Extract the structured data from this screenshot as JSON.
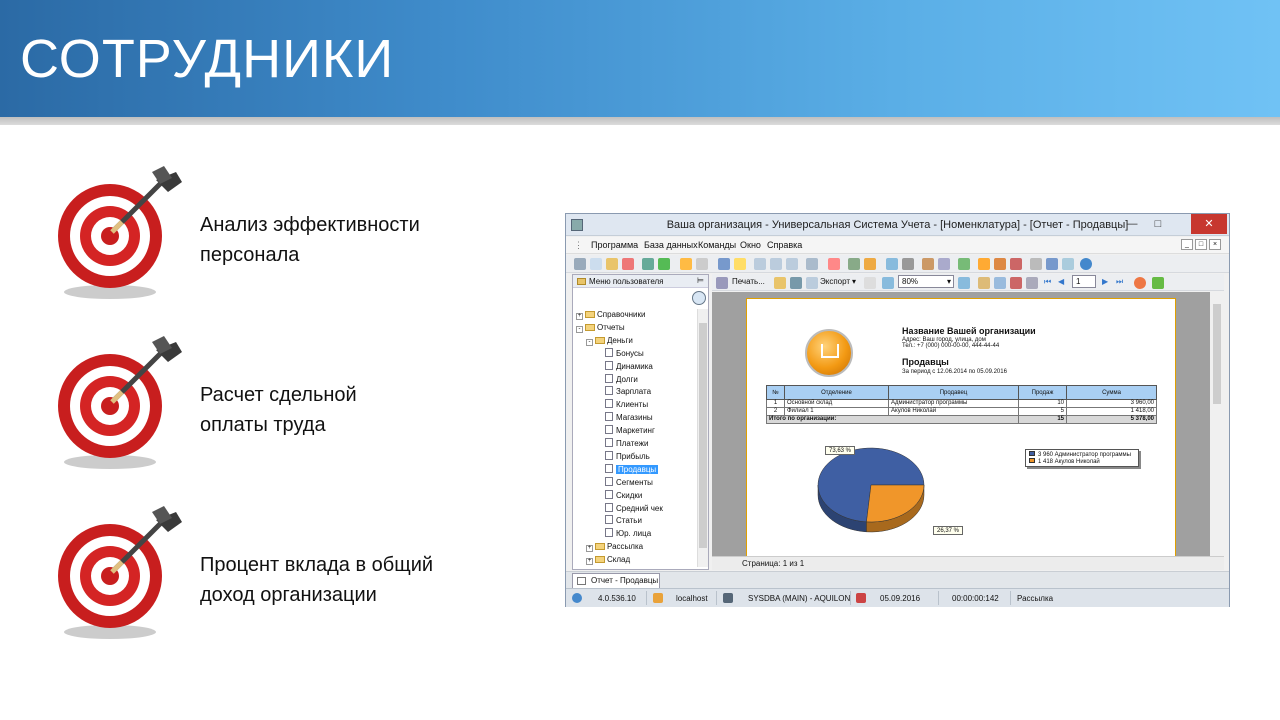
{
  "slide": {
    "title": "СОТРУДНИКИ",
    "bullets": [
      {
        "line1": "Анализ эффективности",
        "line2": "персонала"
      },
      {
        "line1": "Расчет сдельной",
        "line2": "оплаты труда"
      },
      {
        "line1": "Процент вклада в общий",
        "line2": "доход организации"
      }
    ]
  },
  "window": {
    "title": "Ваша организация - Универсальная Система Учета - [Номенклатура] - [Отчет - Продавцы]",
    "menu": [
      "Программа",
      "База данных",
      "Команды",
      "Окно",
      "Справка"
    ],
    "left_panel": {
      "title": "Меню пользователя",
      "tree": [
        {
          "label": "Справочники",
          "level": 0,
          "kind": "folder",
          "pm": "+"
        },
        {
          "label": "Отчеты",
          "level": 0,
          "kind": "folder",
          "pm": "-"
        },
        {
          "label": "Деньги",
          "level": 1,
          "kind": "folder",
          "pm": "-"
        },
        {
          "label": "Бонусы",
          "level": 2,
          "kind": "doc"
        },
        {
          "label": "Динамика",
          "level": 2,
          "kind": "doc"
        },
        {
          "label": "Долги",
          "level": 2,
          "kind": "doc"
        },
        {
          "label": "Зарплата",
          "level": 2,
          "kind": "doc"
        },
        {
          "label": "Клиенты",
          "level": 2,
          "kind": "doc"
        },
        {
          "label": "Магазины",
          "level": 2,
          "kind": "doc"
        },
        {
          "label": "Маркетинг",
          "level": 2,
          "kind": "doc"
        },
        {
          "label": "Платежи",
          "level": 2,
          "kind": "doc"
        },
        {
          "label": "Прибыль",
          "level": 2,
          "kind": "doc"
        },
        {
          "label": "Продавцы",
          "level": 2,
          "kind": "doc",
          "selected": true
        },
        {
          "label": "Сегменты",
          "level": 2,
          "kind": "doc"
        },
        {
          "label": "Скидки",
          "level": 2,
          "kind": "doc"
        },
        {
          "label": "Средний чек",
          "level": 2,
          "kind": "doc"
        },
        {
          "label": "Статьи",
          "level": 2,
          "kind": "doc"
        },
        {
          "label": "Юр. лица",
          "level": 2,
          "kind": "doc"
        },
        {
          "label": "Рассылка",
          "level": 1,
          "kind": "folder",
          "pm": "+"
        },
        {
          "label": "Склад",
          "level": 1,
          "kind": "folder",
          "pm": "+"
        }
      ]
    },
    "report_toolbar": {
      "print": "Печать...",
      "export": "Экспорт",
      "zoom": "80%",
      "page": "1"
    },
    "report": {
      "org_name": "Название Вашей организации",
      "address": "Адрес: Ваш город, улица, дом",
      "phone": "Тел.: +7 (000) 000-00-00, 444-44-44",
      "title": "Продавцы",
      "period": "За период с 12.06.2014 по 05.09.2016",
      "columns": [
        "№",
        "Отделение",
        "Продавец",
        "Продаж",
        "Сумма"
      ],
      "rows": [
        {
          "n": "1",
          "dept": "Основной склад",
          "seller": "Администратор программы",
          "sales": "10",
          "sum": "3 960,00"
        },
        {
          "n": "2",
          "dept": "Филиал 1",
          "seller": "Акулов Николай",
          "sales": "5",
          "sum": "1 418,00"
        }
      ],
      "total": {
        "label": "Итого по организации:",
        "sales": "15",
        "sum": "5 378,00"
      },
      "legend": [
        {
          "text": "3 960 Администратор программы",
          "color": "#3f5fa3"
        },
        {
          "text": "1 418 Акулов Николай",
          "color": "#f0962a"
        }
      ],
      "callouts": [
        "73,63 %",
        "26,37 %"
      ]
    },
    "chart_data": {
      "type": "pie",
      "categories": [
        "Администратор программы",
        "Акулов Николай"
      ],
      "values": [
        3960,
        1418
      ],
      "percent_labels": [
        "73,63 %",
        "26,37 %"
      ],
      "colors": [
        "#3f5fa3",
        "#f0962a"
      ],
      "legend": "top-right"
    },
    "page_status": "Страница: 1 из 1",
    "tab": "Отчет - Продавцы",
    "status": {
      "version": "4.0.536.10",
      "host": "localhost",
      "user": "SYSDBA (MAIN) - AQUILON",
      "date": "05.09.2016",
      "timer": "00:00:00:142",
      "task": "Рассылка"
    }
  }
}
